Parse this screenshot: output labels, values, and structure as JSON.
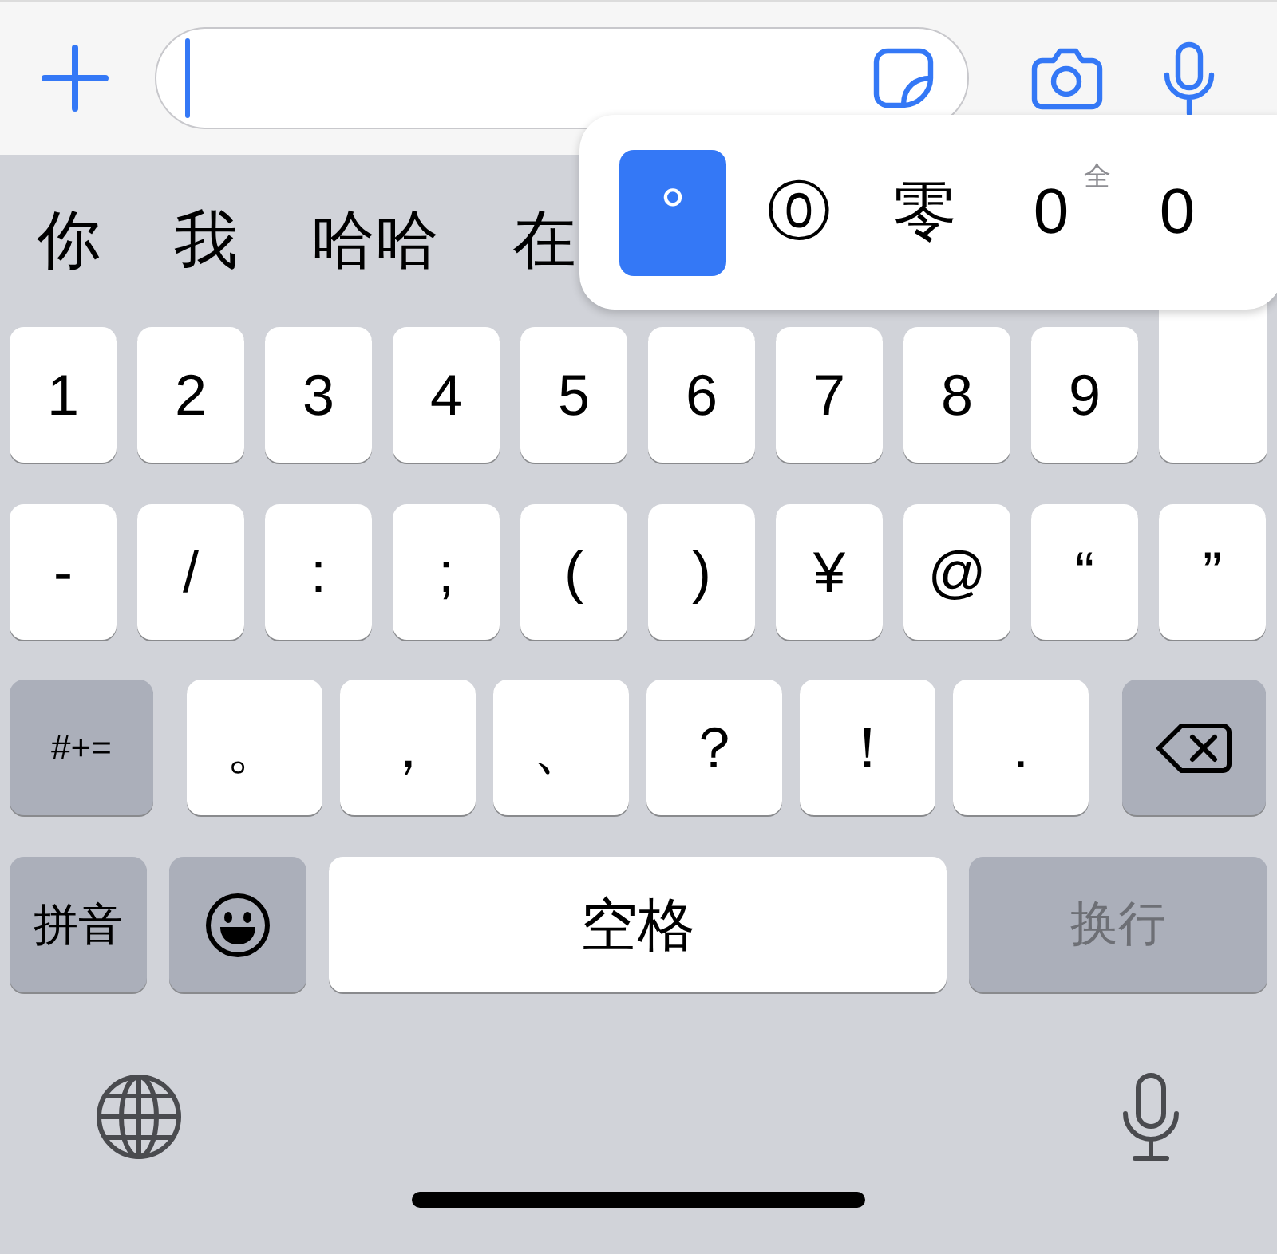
{
  "candidates": [
    "你",
    "我",
    "哈哈",
    "在"
  ],
  "popup": {
    "options": [
      {
        "label": "°",
        "selected": true
      },
      {
        "label": "⓪",
        "selected": false
      },
      {
        "label": "零",
        "selected": false
      },
      {
        "label": "0",
        "sup": "全",
        "selected": false
      },
      {
        "label": "0",
        "selected": false
      }
    ]
  },
  "number_row": [
    "1",
    "2",
    "3",
    "4",
    "5",
    "6",
    "7",
    "8",
    "9"
  ],
  "symbol_row": [
    "-",
    "/",
    ":",
    ";",
    "(",
    ")",
    "¥",
    "@",
    "“",
    "”"
  ],
  "punct_row": {
    "mode_key": "#+=",
    "keys": [
      "。",
      "，",
      "、",
      "？",
      "！",
      "."
    ]
  },
  "bottom_row": {
    "layout_key": "拼音",
    "space": "空格",
    "return_key": {
      "label": "换行",
      "disabled": true
    }
  }
}
